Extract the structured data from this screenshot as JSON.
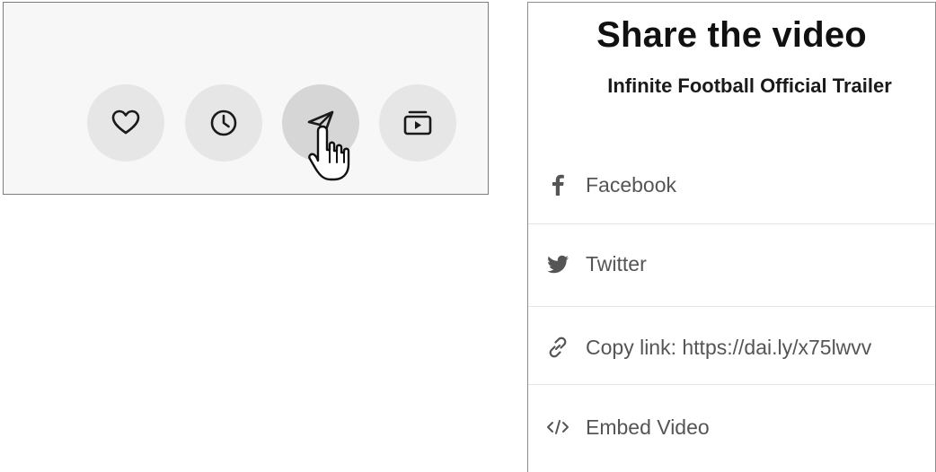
{
  "action_bar": {
    "buttons": [
      {
        "name": "like-button",
        "icon": "heart-icon",
        "active": false
      },
      {
        "name": "watch-later-button",
        "icon": "clock-icon",
        "active": false
      },
      {
        "name": "share-button",
        "icon": "paper-plane-icon",
        "active": true
      },
      {
        "name": "add-to-playlist-button",
        "icon": "playlist-icon",
        "active": false
      }
    ],
    "cursor": "hand-pointer-icon"
  },
  "share": {
    "title": "Share the video",
    "subtitle": "Infinite Football Official Trailer",
    "options": {
      "facebook": {
        "label": "Facebook",
        "icon": "facebook-icon"
      },
      "twitter": {
        "label": "Twitter",
        "icon": "twitter-icon"
      },
      "copy_link": {
        "label": "Copy link: https://dai.ly/x75lwvv",
        "icon": "link-icon"
      },
      "embed": {
        "label": "Embed Video",
        "icon": "code-icon"
      }
    }
  },
  "colors": {
    "button_bg": "#e6e6e6",
    "button_active_bg": "#d6d6d6",
    "icon_stroke": "#1a1a1a",
    "option_text": "#555555"
  }
}
